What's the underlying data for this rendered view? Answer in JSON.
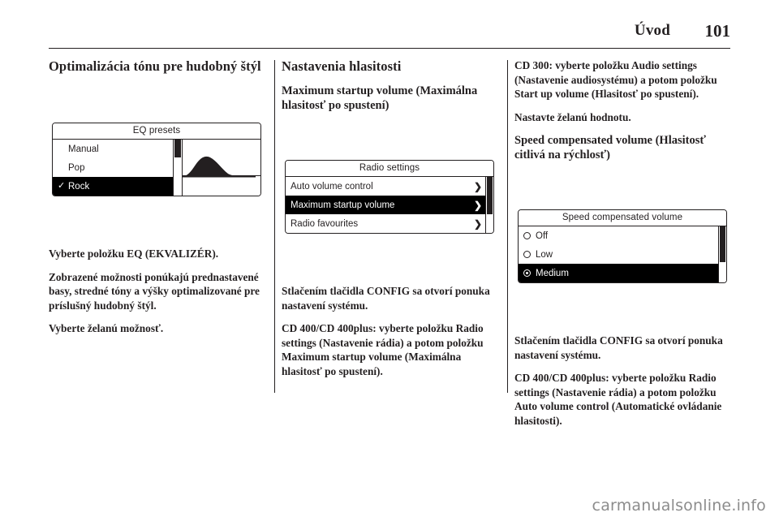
{
  "header": {
    "title": "Úvod",
    "page_number": "101"
  },
  "columns": {
    "left": {
      "heading": "Optimalizácia tónu pre hudobný štýl",
      "figure": {
        "name": "eq-presets-screen",
        "title": "EQ presets",
        "items": [
          {
            "label": "Manual",
            "selected": false,
            "check": ""
          },
          {
            "label": "Pop",
            "selected": false,
            "check": ""
          },
          {
            "label": "Rock",
            "selected": true,
            "check": "✓"
          }
        ]
      },
      "paragraphs": [
        "Vyberte položku EQ (EKVALIZÉR).",
        "Zobrazené možnosti ponúkajú prednastavené basy, stredné tóny a výšky optimalizované pre príslušný hudobný štýl.",
        "Vyberte želanú možnosť."
      ]
    },
    "middle": {
      "heading": "Nastavenia hlasitosti",
      "subheading": "Maximum startup volume (Maximálna hlasitosť po spustení)",
      "figure": {
        "name": "radio-settings-screen",
        "title": "Radio settings",
        "items": [
          {
            "label": "Auto volume control",
            "selected": false,
            "chevron": "❯"
          },
          {
            "label": "Maximum startup volume",
            "selected": true,
            "chevron": "❯"
          },
          {
            "label": "Radio favourites",
            "selected": false,
            "chevron": "❯"
          }
        ]
      },
      "paragraphs": [
        "Stlačením tlačidla CONFIG sa otvorí ponuka nastavení systému.",
        "CD 400/CD 400plus: vyberte položku Radio settings (Nastavenie rádia) a potom položku Maximum startup volume (Maximálna hlasitosť po spustení)."
      ]
    },
    "right": {
      "paragraphs_top": [
        "CD 300: vyberte položku Audio settings (Nastavenie audiosystému) a potom položku Start up volume (Hlasitosť po spustení).",
        "Nastavte želanú hodnotu."
      ],
      "subheading": "Speed compensated volume (Hlasitosť citlivá na rýchlosť)",
      "figure": {
        "name": "speed-compensated-volume-screen",
        "title": "Speed compensated volume",
        "items": [
          {
            "label": "Off",
            "selected": false,
            "checked": false
          },
          {
            "label": "Low",
            "selected": false,
            "checked": false
          },
          {
            "label": "Medium",
            "selected": true,
            "checked": true
          }
        ]
      },
      "paragraphs_bottom": [
        "Stlačením tlačidla CONFIG sa otvorí ponuka nastavení systému.",
        "CD 400/CD 400plus: vyberte položku Radio settings (Nastavenie rádia) a potom položku Auto volume control (Automatické ovládanie hlasitosti)."
      ]
    }
  },
  "watermark": "carmanualsonline.info"
}
